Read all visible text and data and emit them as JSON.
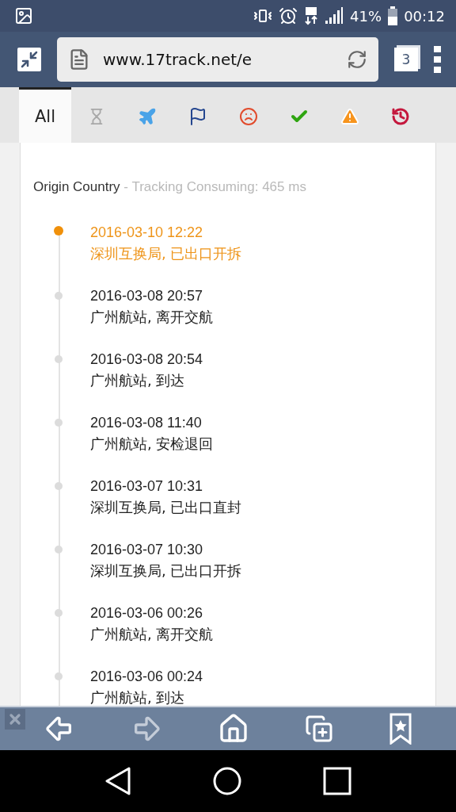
{
  "status_bar": {
    "battery": "41%",
    "time": "00:12"
  },
  "browser": {
    "url": "www.17track.net/e",
    "tab_count": "3"
  },
  "filter_tabs": [
    {
      "kind": "text",
      "label": "All",
      "selected": true
    },
    {
      "kind": "pending",
      "selected": false
    },
    {
      "kind": "transit",
      "selected": false
    },
    {
      "kind": "pickup",
      "selected": false
    },
    {
      "kind": "undelivered",
      "selected": false
    },
    {
      "kind": "delivered",
      "selected": false
    },
    {
      "kind": "alert",
      "selected": false
    },
    {
      "kind": "expired",
      "selected": false
    }
  ],
  "tracking": {
    "origin": "Origin Country",
    "note": "- Tracking Consuming: 465 ms",
    "events": [
      {
        "time": "2016-03-10 12:22",
        "place": "深圳互换局, 已出口开拆",
        "latest": true
      },
      {
        "time": "2016-03-08 20:57",
        "place": "广州航站, 离开交航",
        "latest": false
      },
      {
        "time": "2016-03-08 20:54",
        "place": "广州航站, 到达",
        "latest": false
      },
      {
        "time": "2016-03-08 11:40",
        "place": "广州航站, 安检退回",
        "latest": false
      },
      {
        "time": "2016-03-07 10:31",
        "place": "深圳互换局, 已出口直封",
        "latest": false
      },
      {
        "time": "2016-03-07 10:30",
        "place": "深圳互换局, 已出口开拆",
        "latest": false
      },
      {
        "time": "2016-03-06 00:26",
        "place": "广州航站, 离开交航",
        "latest": false
      },
      {
        "time": "2016-03-06 00:24",
        "place": "广州航站, 到达",
        "latest": false
      }
    ]
  },
  "bottom_toolbar": [
    {
      "kind": "back",
      "disabled": false
    },
    {
      "kind": "forward",
      "disabled": true
    },
    {
      "kind": "home",
      "disabled": false
    },
    {
      "kind": "new-tab",
      "disabled": false
    },
    {
      "kind": "bookmark",
      "disabled": false
    }
  ]
}
